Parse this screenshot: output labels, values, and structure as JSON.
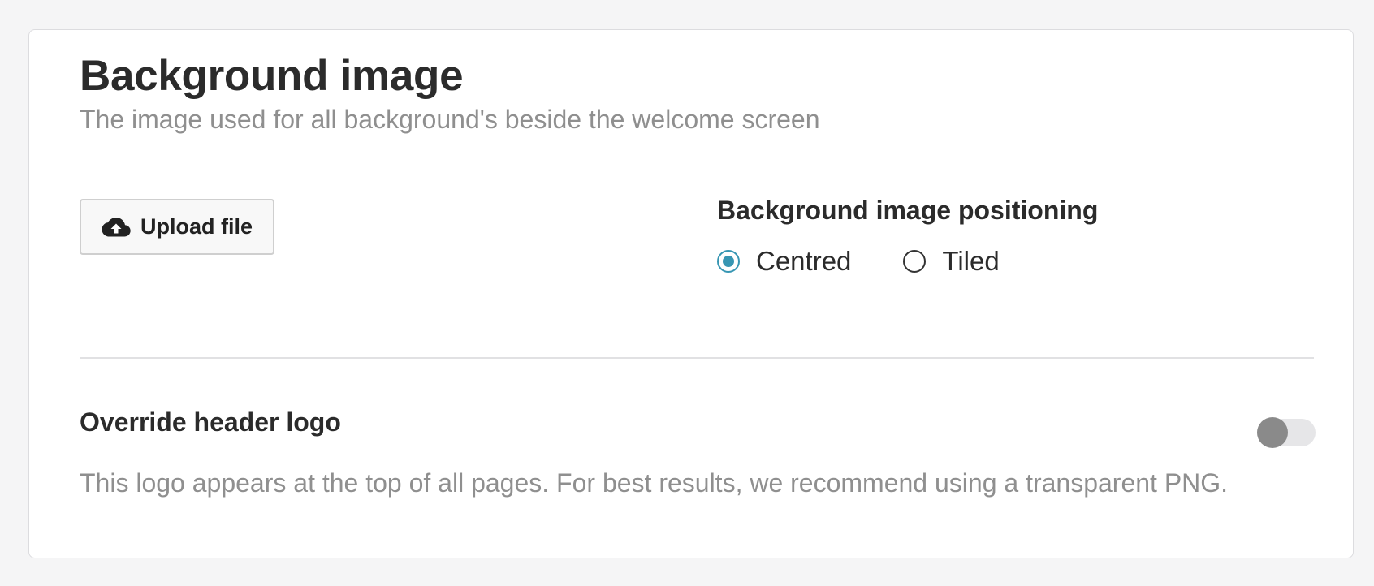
{
  "background_section": {
    "title": "Background image",
    "subtitle": "The image used for all background's beside the welcome screen",
    "upload_button": {
      "label": "Upload file",
      "icon": "cloud-upload-icon"
    },
    "positioning": {
      "title": "Background image positioning",
      "options": [
        {
          "label": "Centred",
          "selected": true
        },
        {
          "label": "Tiled",
          "selected": false
        }
      ]
    }
  },
  "override_logo": {
    "title": "Override header logo",
    "description": "This logo appears at the top of all pages. For best results, we recommend using a transparent PNG.",
    "toggle_on": false
  },
  "colors": {
    "accent": "#3796b3",
    "toggle_track": "#e6e6e8",
    "toggle_knob": "#8a8a8a",
    "muted_text": "#8f8f8f"
  }
}
